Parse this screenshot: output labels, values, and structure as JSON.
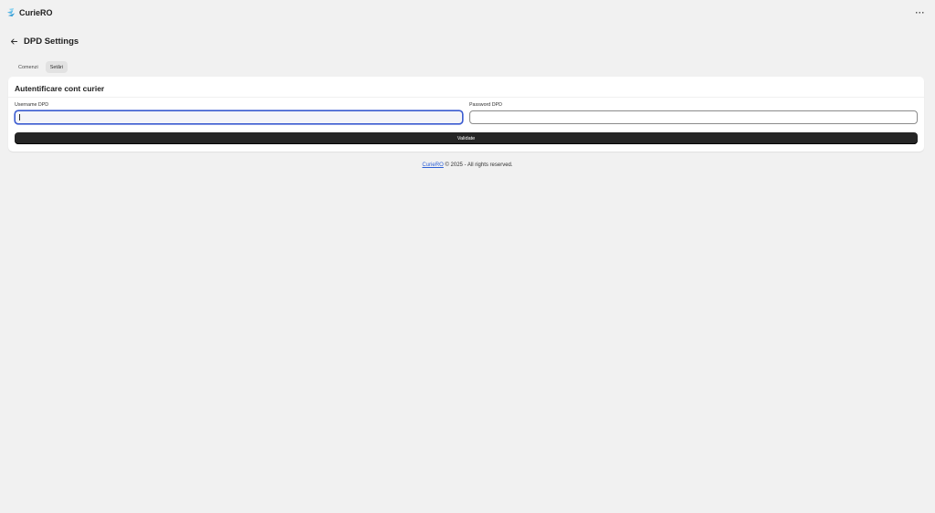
{
  "app": {
    "name": "CurieRO",
    "more_label": "···"
  },
  "page": {
    "title": "DPD Settings"
  },
  "tabs": [
    {
      "label": "Comenzi",
      "active": false
    },
    {
      "label": "Setări",
      "active": true
    }
  ],
  "card": {
    "title": "Autentificare cont curier",
    "username_label": "Username DPD",
    "username_value": "",
    "password_label": "Password DPD",
    "password_value": "",
    "validate_label": "Validate"
  },
  "footer": {
    "link": "CurieRO",
    "text": " © 2025 - All rights reserved."
  },
  "colors": {
    "accent": "#3a5bd0",
    "link": "#2c5fd6",
    "button": "#262626",
    "background": "#f1f1f1"
  }
}
